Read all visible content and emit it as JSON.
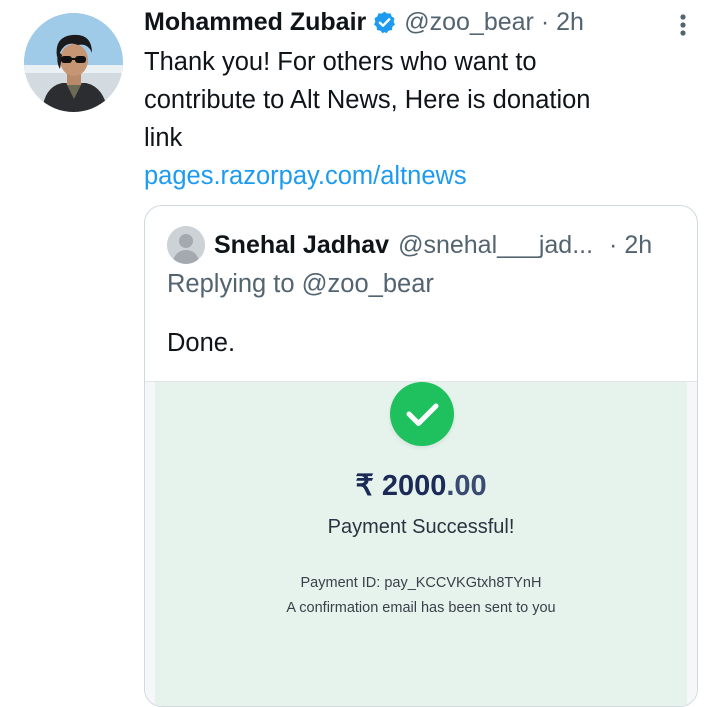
{
  "tweet": {
    "author_name": "Mohammed Zubair",
    "handle": "@zoo_bear",
    "time": "2h",
    "text_lines": "Thank you! For others who want to\ncontribute to Alt News, Here is donation\nlink",
    "link": "pages.razorpay.com/altnews"
  },
  "quoted": {
    "author_name": "Snehal Jadhav",
    "handle": "@snehal___jad...",
    "time": "2h",
    "replying_to": "Replying to @zoo_bear",
    "text": "Done."
  },
  "receipt": {
    "currency_symbol": "₹",
    "amount_whole": "2000",
    "amount_decimal": ".00",
    "status": "Payment Successful!",
    "payment_id": "Payment ID: pay_KCCVKGtxh8TYnH",
    "confirmation": "A confirmation email has been sent to you"
  },
  "colors": {
    "link": "#1d9bf0",
    "verified": "#1d9bf0",
    "success": "#1ec15e",
    "amount": "#1c2a57"
  }
}
